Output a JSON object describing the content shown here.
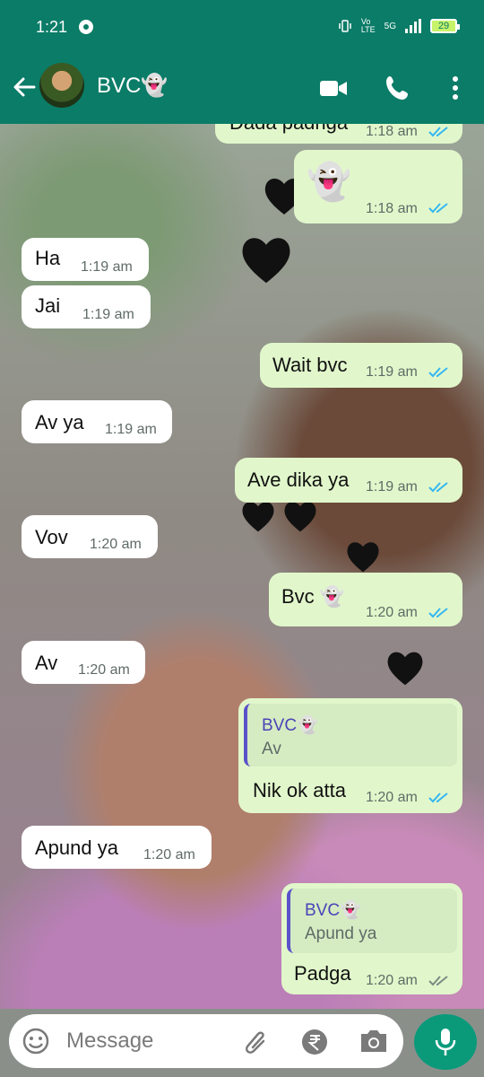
{
  "status_bar": {
    "time": "1:21",
    "network_small": "Vo\nLTE",
    "network_5g": "5G",
    "battery": "29"
  },
  "header": {
    "contact_name": "BVC👻"
  },
  "messages": [
    {
      "direction": "out",
      "text": "Dada padnga",
      "time": "1:18 am"
    },
    {
      "direction": "out",
      "text": "👻",
      "time": "1:18 am"
    },
    {
      "direction": "in",
      "text": "Ha",
      "time": "1:19 am"
    },
    {
      "direction": "in",
      "text": "Jai",
      "time": "1:19 am"
    },
    {
      "direction": "out",
      "text": "Wait bvc",
      "time": "1:19 am"
    },
    {
      "direction": "in",
      "text": "Av ya",
      "time": "1:19 am"
    },
    {
      "direction": "out",
      "text": "Ave dika ya",
      "time": "1:19 am"
    },
    {
      "direction": "in",
      "text": "Vov",
      "time": "1:20 am"
    },
    {
      "direction": "out",
      "text": "Bvc 👻",
      "time": "1:20 am"
    },
    {
      "direction": "in",
      "text": "Av",
      "time": "1:20 am"
    },
    {
      "direction": "out",
      "quoted": {
        "name": "BVC👻",
        "text": "Av"
      },
      "text": "Nik ok atta",
      "time": "1:20 am"
    },
    {
      "direction": "in",
      "text": "Apund ya",
      "time": "1:20 am"
    },
    {
      "direction": "out",
      "quoted": {
        "name": "BVC👻",
        "text": "Apund ya"
      },
      "text": "Padga",
      "time": "1:20 am"
    }
  ],
  "composer": {
    "placeholder": "Message"
  },
  "colors": {
    "header": "#0a7c67",
    "outgoing_bubble": "#e1f7cb",
    "incoming_bubble": "#ffffff",
    "read_ticks": "#34b7f1"
  },
  "icons": [
    "back-arrow-icon",
    "video-call-icon",
    "voice-call-icon",
    "more-options-icon",
    "emoji-icon",
    "attach-icon",
    "rupee-payment-icon",
    "camera-icon",
    "microphone-icon"
  ]
}
